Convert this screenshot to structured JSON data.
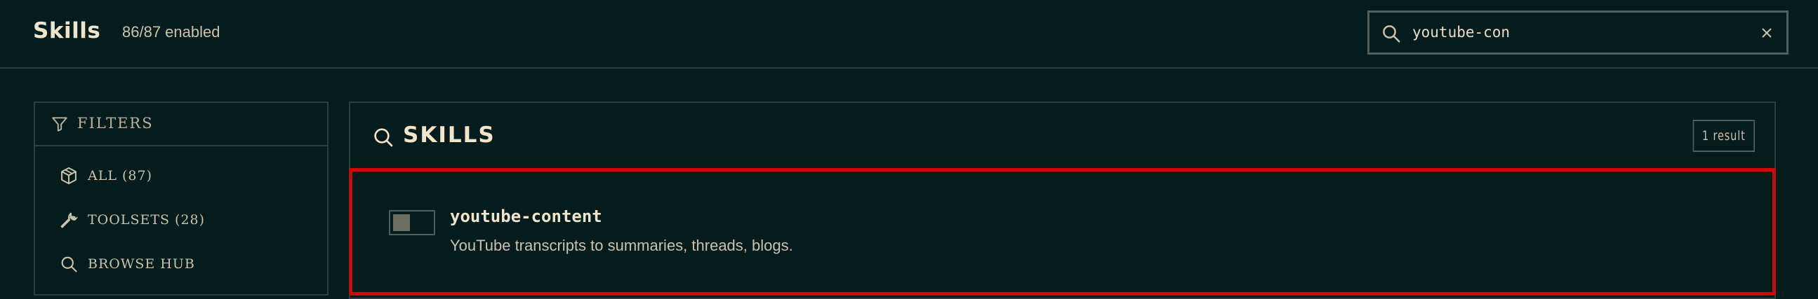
{
  "header": {
    "title": "Skills",
    "enabled_count": "86/87 enabled"
  },
  "search": {
    "value": "youtube-con",
    "icon": "search-icon",
    "clear_icon": "close-icon"
  },
  "filters": {
    "heading": "FILTERS",
    "items": [
      {
        "label": "ALL (87)",
        "icon": "box-icon"
      },
      {
        "label": "TOOLSETS (28)",
        "icon": "wrench-icon"
      },
      {
        "label": "BROWSE HUB",
        "icon": "search-icon"
      }
    ]
  },
  "main": {
    "title": "SKILLS",
    "result_badge": "1 result",
    "skills": [
      {
        "name": "youtube-content",
        "description": "YouTube transcripts to summaries, threads, blogs.",
        "enabled": false
      }
    ]
  },
  "colors": {
    "background": "#041c1c",
    "border": "#2a403b",
    "highlight": "#e00000",
    "text": "#e8dfc8"
  }
}
